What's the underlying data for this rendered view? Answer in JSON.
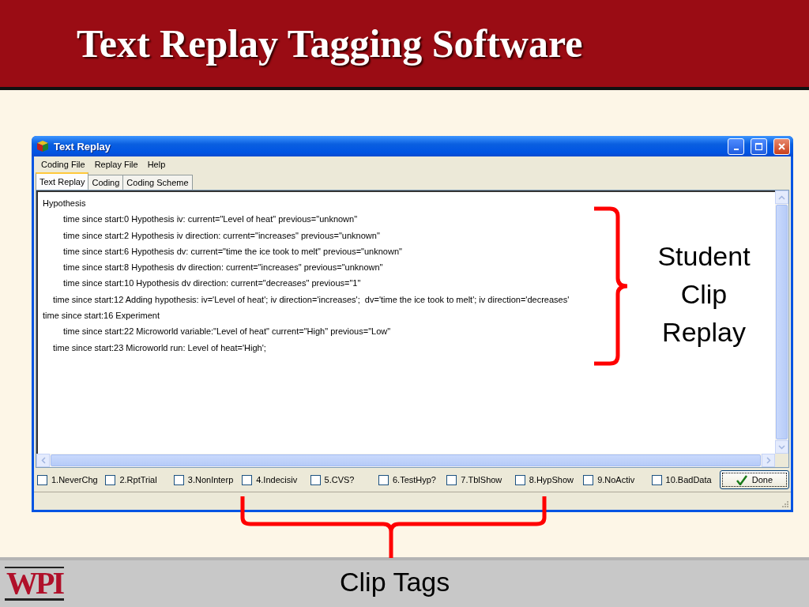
{
  "slide": {
    "title": "Text Replay Tagging Software",
    "logo": "WPI"
  },
  "window": {
    "title": "Text Replay",
    "menu": [
      "Coding File",
      "Replay File",
      "Help"
    ],
    "tabs": [
      {
        "label": "Text Replay",
        "selected": true
      },
      {
        "label": "Coding",
        "selected": false
      },
      {
        "label": "Coding Scheme",
        "selected": false
      }
    ],
    "log": [
      {
        "kind": "section",
        "text": "Hypothesis"
      },
      {
        "kind": "step",
        "text": "time since start:0 Hypothesis iv: current=\"Level of heat\" previous=\"unknown\""
      },
      {
        "kind": "step",
        "text": "time since start:2 Hypothesis iv direction: current=\"increases\" previous=\"unknown\""
      },
      {
        "kind": "step",
        "text": "time since start:6 Hypothesis dv: current=\"time the ice took to melt\" previous=\"unknown\""
      },
      {
        "kind": "step",
        "text": "time since start:8 Hypothesis dv direction: current=\"increases\" previous=\"unknown\""
      },
      {
        "kind": "step",
        "text": "time since start:10 Hypothesis dv direction: current=\"decreases\" previous=\"1\""
      },
      {
        "kind": "result",
        "text": "time since start:12 Adding hypothesis: iv='Level of heat'; iv direction='increases';  dv='time the ice took to melt'; iv direction='decreases'"
      },
      {
        "kind": "section",
        "text": "time since start:16 Experiment"
      },
      {
        "kind": "step",
        "text": "time since start:22 Microworld variable:\"Level of heat\" current=\"High\" previous=\"Low\""
      },
      {
        "kind": "result",
        "text": "time since start:23 Microworld run: Level of heat='High';"
      }
    ],
    "tags": [
      {
        "label": "1.NeverChg",
        "checked": false
      },
      {
        "label": "2.RptTrial",
        "checked": false
      },
      {
        "label": "3.NonInterp",
        "checked": false
      },
      {
        "label": "4.Indecisiv",
        "checked": false
      },
      {
        "label": "5.CVS?",
        "checked": false
      },
      {
        "label": "6.TestHyp?",
        "checked": false
      },
      {
        "label": "7.TblShow",
        "checked": false
      },
      {
        "label": "8.HypShow",
        "checked": false
      },
      {
        "label": "9.NoActiv",
        "checked": false
      },
      {
        "label": "10.BadData",
        "checked": false
      }
    ],
    "done_button": "Done"
  },
  "annotations": {
    "replay_label": "Student Clip Replay",
    "tags_label": "Clip Tags"
  }
}
